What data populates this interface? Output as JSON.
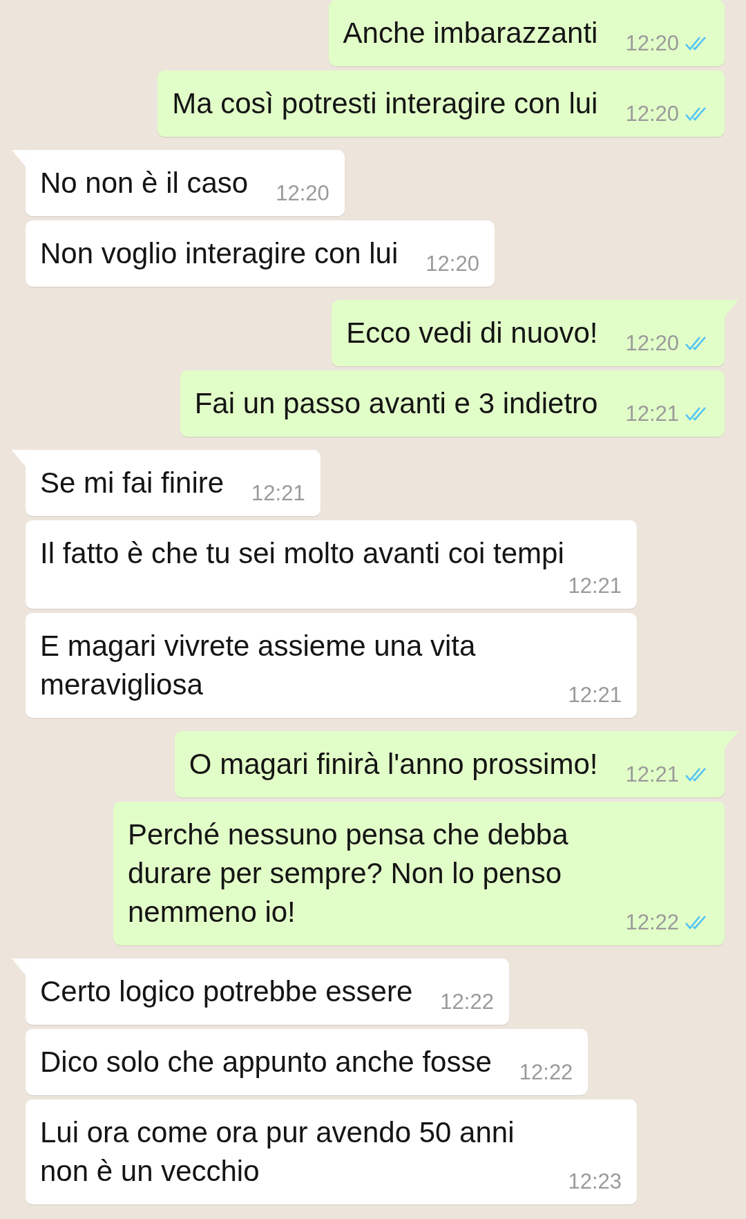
{
  "messages": [
    {
      "outgoing": true,
      "tail": false,
      "text": "Anche imbarazzanti",
      "time": "12:20",
      "read": true
    },
    {
      "outgoing": true,
      "tail": false,
      "text": "Ma così potresti interagire con lui",
      "time": "12:20",
      "read": true
    },
    {
      "outgoing": false,
      "tail": true,
      "text": "No non è il caso",
      "time": "12:20"
    },
    {
      "outgoing": false,
      "tail": false,
      "text": "Non voglio interagire con lui",
      "time": "12:20"
    },
    {
      "outgoing": true,
      "tail": true,
      "text": "Ecco vedi di nuovo!",
      "time": "12:20",
      "read": true
    },
    {
      "outgoing": true,
      "tail": false,
      "text": "Fai un passo avanti e 3 indietro",
      "time": "12:21",
      "read": true
    },
    {
      "outgoing": false,
      "tail": true,
      "text": "Se mi fai finire",
      "time": "12:21"
    },
    {
      "outgoing": false,
      "tail": false,
      "text": "Il fatto è che tu sei molto avanti coi tempi",
      "time": "12:21"
    },
    {
      "outgoing": false,
      "tail": false,
      "text": "E magari vivrete assieme una vita meravigliosa",
      "time": "12:21"
    },
    {
      "outgoing": true,
      "tail": true,
      "text": "O magari finirà l'anno prossimo!",
      "time": "12:21",
      "read": true
    },
    {
      "outgoing": true,
      "tail": false,
      "text": "Perché nessuno pensa che debba durare per sempre? Non lo penso nemmeno io!",
      "time": "12:22",
      "read": true
    },
    {
      "outgoing": false,
      "tail": true,
      "text": "Certo logico potrebbe essere",
      "time": "12:22"
    },
    {
      "outgoing": false,
      "tail": false,
      "text": "Dico solo che appunto anche fosse",
      "time": "12:22"
    },
    {
      "outgoing": false,
      "tail": false,
      "text": "Lui ora come ora pur avendo 50 anni non è un vecchio",
      "time": "12:23"
    }
  ]
}
